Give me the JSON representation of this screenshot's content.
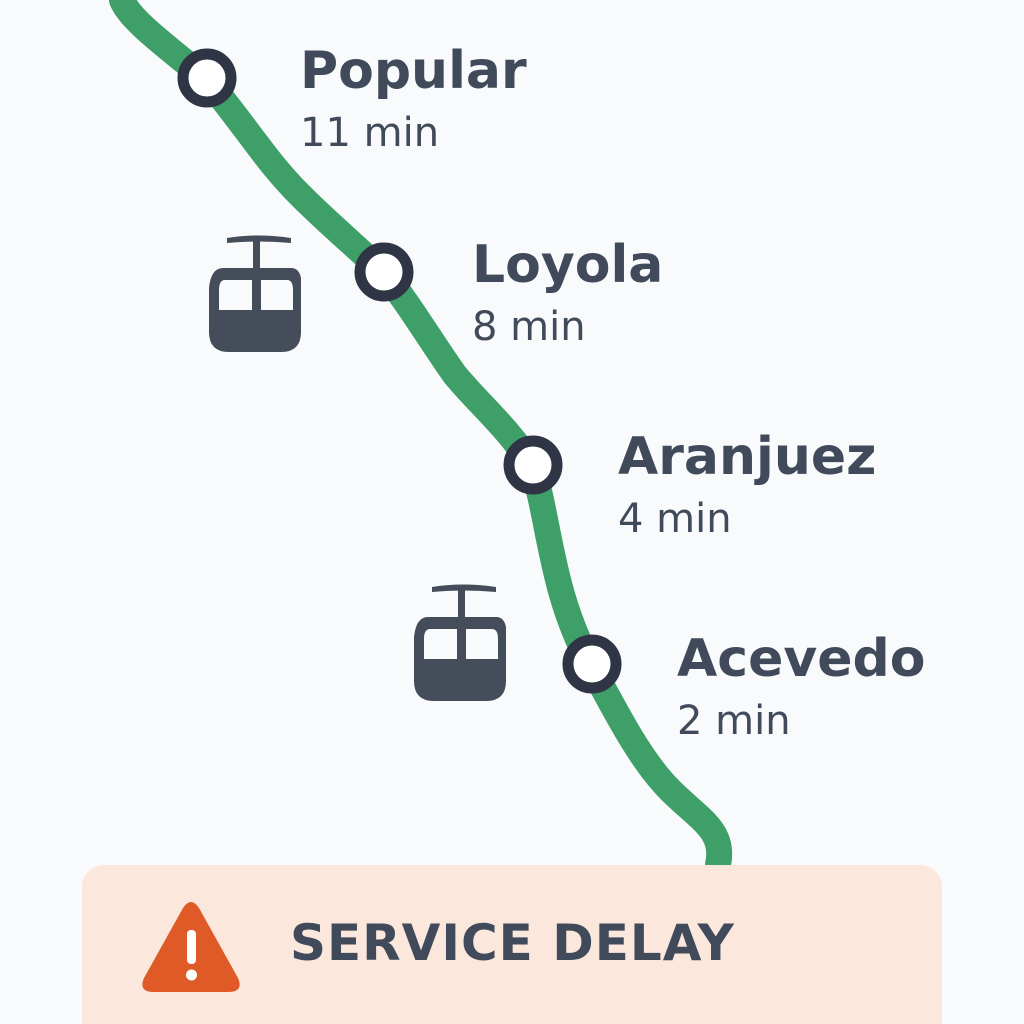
{
  "line": {
    "color": "#3e9f69",
    "station_marker_color": "#2f3545"
  },
  "stations": [
    {
      "name": "Popular",
      "eta": "11 min"
    },
    {
      "name": "Loyola",
      "eta": "8 min"
    },
    {
      "name": "Aranjuez",
      "eta": "4 min"
    },
    {
      "name": "Acevedo",
      "eta": "2 min"
    }
  ],
  "icons": {
    "vehicle": "cable-car-icon",
    "alert": "warning-triangle-icon"
  },
  "alert": {
    "text": "SERVICE DELAY",
    "icon_color": "#e05a28",
    "background": "#fbe7dc"
  }
}
